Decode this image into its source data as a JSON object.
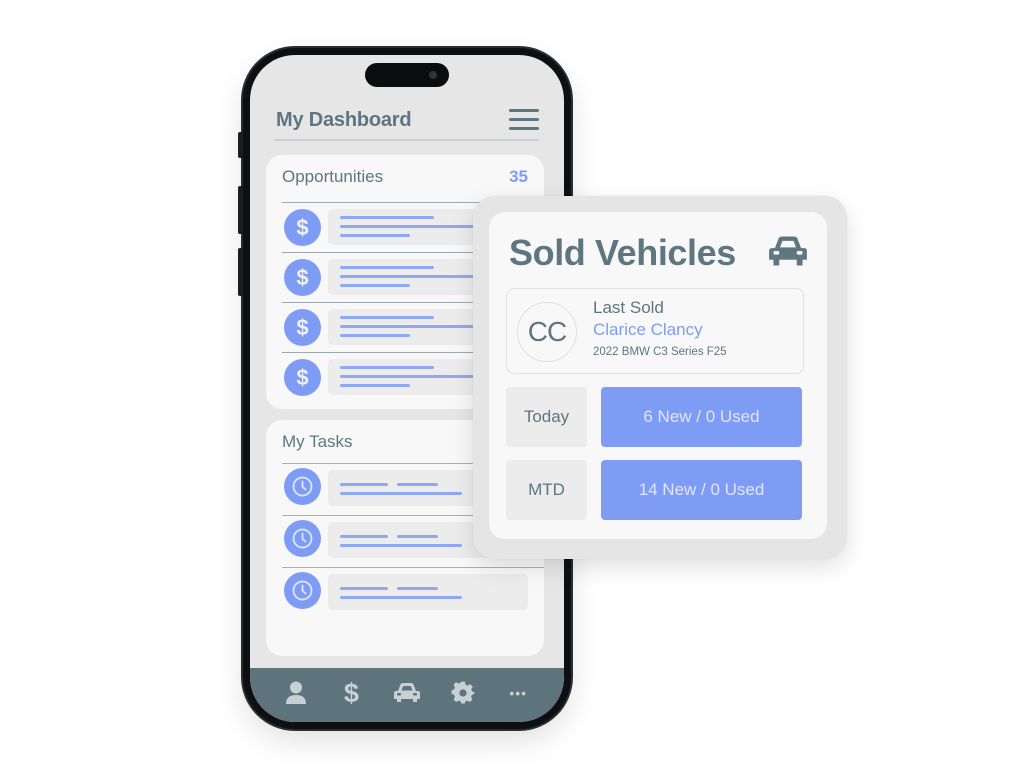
{
  "phone": {
    "header": {
      "title": "My Dashboard",
      "menu_icon": "hamburger-menu-icon"
    },
    "opportunities": {
      "title": "Opportunities",
      "count": "35",
      "items": [
        {
          "icon": "dollar-icon",
          "glyph": "$"
        },
        {
          "icon": "dollar-icon",
          "glyph": "$"
        },
        {
          "icon": "dollar-icon",
          "glyph": "$"
        },
        {
          "icon": "dollar-icon",
          "glyph": "$"
        }
      ]
    },
    "tasks": {
      "title": "My Tasks",
      "items": [
        {
          "icon": "clock-icon"
        },
        {
          "icon": "clock-icon"
        },
        {
          "icon": "clock-icon"
        }
      ]
    },
    "tabbar": [
      {
        "name": "profile",
        "icon": "person-icon"
      },
      {
        "name": "opportunities",
        "icon": "dollar-icon",
        "glyph": "$"
      },
      {
        "name": "vehicles",
        "icon": "car-icon"
      },
      {
        "name": "settings",
        "icon": "gear-icon"
      },
      {
        "name": "more",
        "icon": "more-dots-icon",
        "glyph": "•••"
      }
    ]
  },
  "sold_vehicles": {
    "title": "Sold Vehicles",
    "icon": "car-icon",
    "last_sold": {
      "label": "Last Sold",
      "initials": "CC",
      "customer": "Clarice Clancy",
      "vehicle": "2022 BMW C3 Series F25"
    },
    "stats": [
      {
        "period": "Today",
        "value": "6 New / 0 Used"
      },
      {
        "period": "MTD",
        "value": "14 New / 0 Used"
      }
    ]
  },
  "colors": {
    "accent": "#7f9cf5",
    "text_primary": "#5e7680",
    "tabbar": "#5d747d",
    "screen_bg": "#e6e6e6",
    "card_bg": "#f8f8f8"
  }
}
